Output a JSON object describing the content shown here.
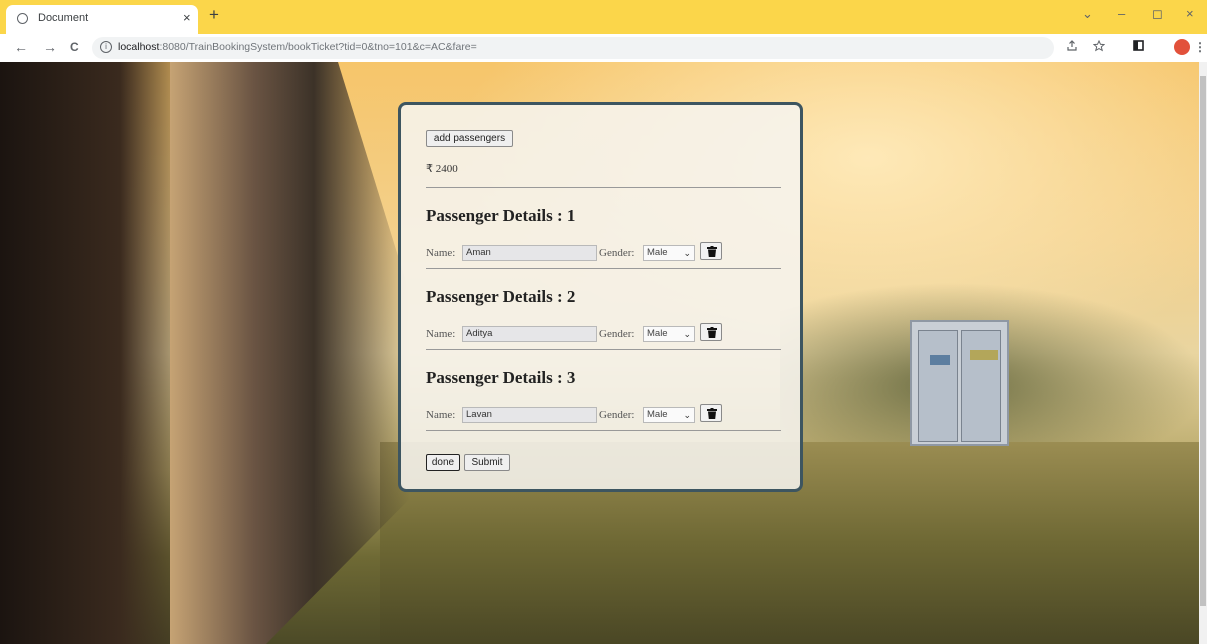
{
  "browser": {
    "tab_title": "Document",
    "tab_close": "×",
    "new_tab": "+",
    "url_host": "localhost",
    "url_rest": ":8080/TrainBookingSystem/bookTicket?tid=0&tno=101&c=AC&fare=",
    "nav": {
      "back": "←",
      "forward": "→",
      "reload": "C"
    },
    "window_controls": {
      "collapse": "⌄",
      "minimize": "–",
      "maximize": "◻",
      "close": "×"
    },
    "icons": [
      "share-icon",
      "star-icon",
      "sidebar-icon",
      "profile-avatar",
      "menu-icon"
    ]
  },
  "form": {
    "add_passengers_label": "add passengers",
    "fare": "₹ 2400",
    "passengers": [
      {
        "heading": "Passenger Details : 1",
        "name_label": "Name:",
        "name_value": "Aman",
        "gender_label": "Gender:",
        "gender_value": "Male"
      },
      {
        "heading": "Passenger Details : 2",
        "name_label": "Name:",
        "name_value": "Aditya",
        "gender_label": "Gender:",
        "gender_value": "Male"
      },
      {
        "heading": "Passenger Details : 3",
        "name_label": "Name:",
        "name_value": "Lavan",
        "gender_label": "Gender:",
        "gender_value": "Male"
      }
    ],
    "done_label": "done",
    "submit_label": "Submit"
  }
}
